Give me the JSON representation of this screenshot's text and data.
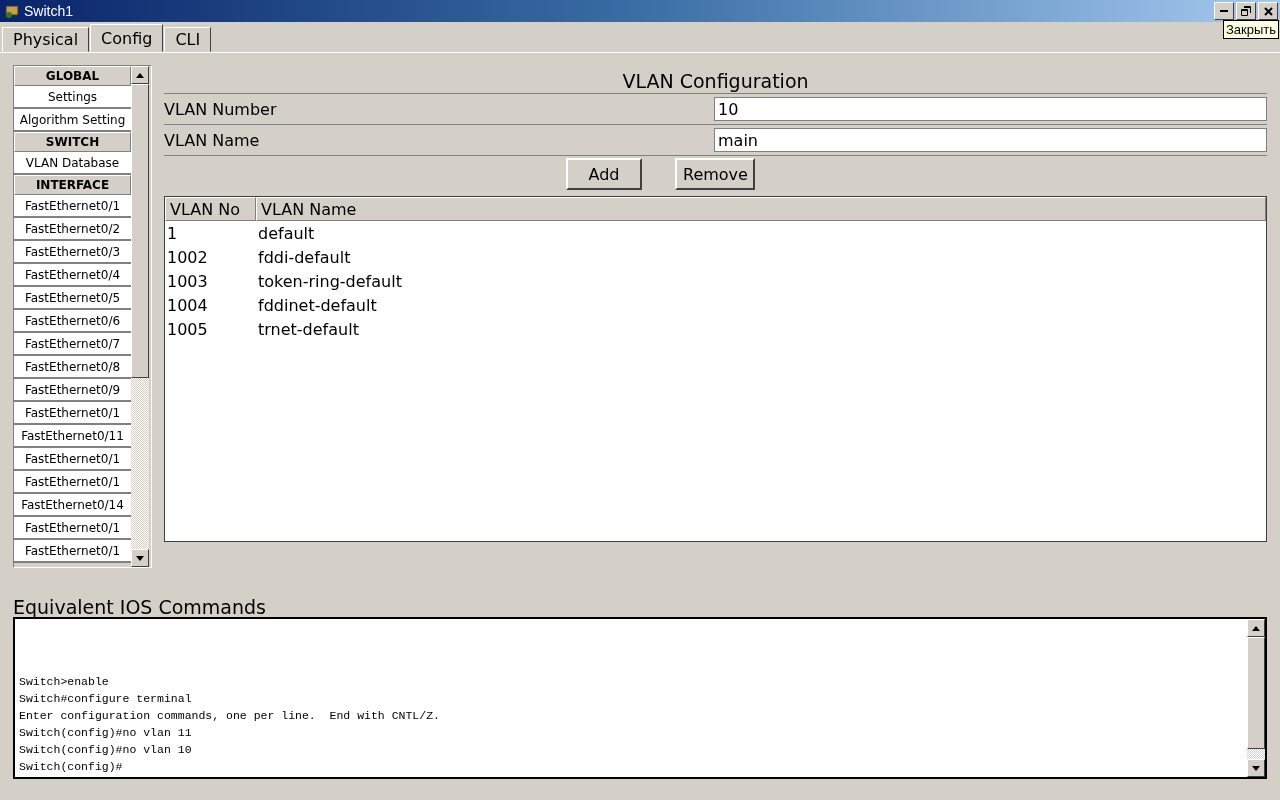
{
  "window": {
    "title": "Switch1",
    "tooltip": "Закрыть"
  },
  "tabs": [
    {
      "label": "Physical",
      "selected": false
    },
    {
      "label": "Config",
      "selected": true
    },
    {
      "label": "CLI",
      "selected": false
    }
  ],
  "sidebar": {
    "sections": [
      {
        "header": "GLOBAL",
        "items": [
          "Settings",
          "Algorithm Setting"
        ]
      },
      {
        "header": "SWITCH",
        "items": [
          "VLAN Database"
        ]
      },
      {
        "header": "INTERFACE",
        "items": [
          "FastEthernet0/1",
          "FastEthernet0/2",
          "FastEthernet0/3",
          "FastEthernet0/4",
          "FastEthernet0/5",
          "FastEthernet0/6",
          "FastEthernet0/7",
          "FastEthernet0/8",
          "FastEthernet0/9",
          "FastEthernet0/1",
          "FastEthernet0/11",
          "FastEthernet0/1",
          "FastEthernet0/1",
          "FastEthernet0/14",
          "FastEthernet0/1",
          "FastEthernet0/1"
        ]
      }
    ]
  },
  "vlan": {
    "title": "VLAN Configuration",
    "fields": [
      {
        "label": "VLAN Number",
        "value": "10"
      },
      {
        "label": "VLAN Name",
        "value": "main"
      }
    ],
    "buttons": [
      "Add",
      "Remove"
    ],
    "table": {
      "columns": [
        "VLAN No",
        "VLAN Name"
      ],
      "rows": [
        [
          "1",
          "default"
        ],
        [
          "1002",
          "fddi-default"
        ],
        [
          "1003",
          "token-ring-default"
        ],
        [
          "1004",
          "fddinet-default"
        ],
        [
          "1005",
          "trnet-default"
        ]
      ]
    }
  },
  "ios": {
    "title": "Equivalent IOS Commands",
    "lines": [
      "Switch>enable",
      "Switch#configure terminal",
      "Enter configuration commands, one per line.  End with CNTL/Z.",
      "Switch(config)#no vlan 11",
      "Switch(config)#no vlan 10",
      "Switch(config)#"
    ]
  }
}
